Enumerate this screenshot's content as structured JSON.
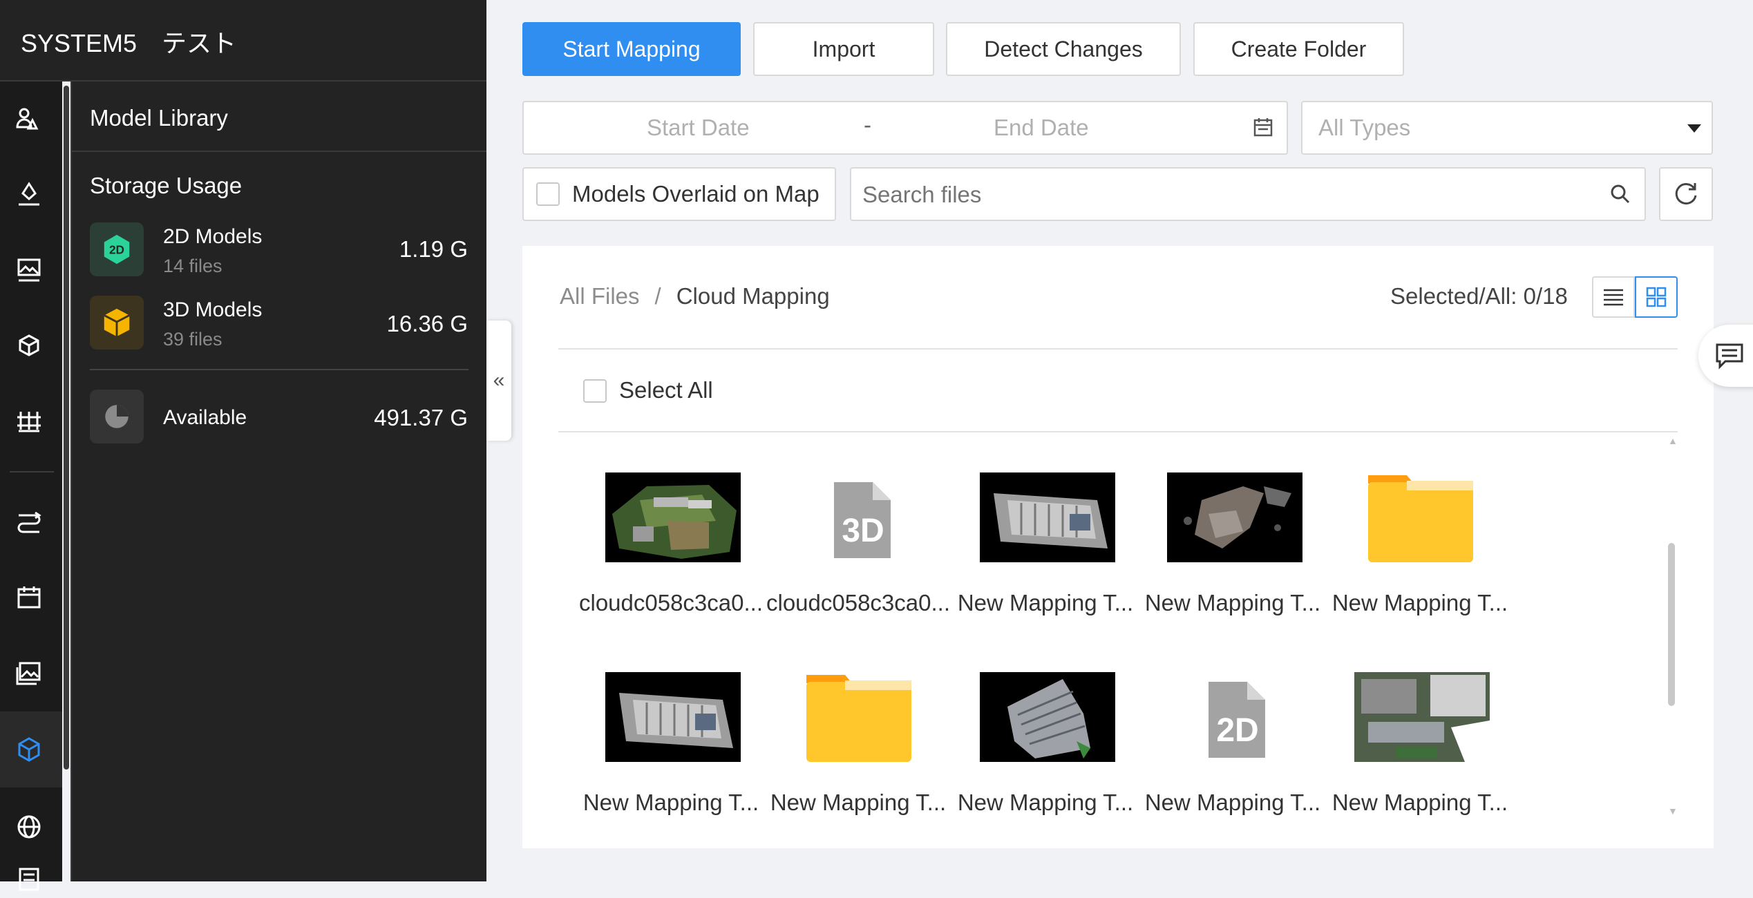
{
  "app": {
    "title": "SYSTEM5　テスト"
  },
  "rail": {
    "icons": [
      "team-icon",
      "waypoint-icon",
      "map-icon",
      "model-icon",
      "fence-icon",
      "route-icon",
      "calendar-icon",
      "gallery-icon",
      "cube-icon",
      "globe-icon",
      "document-icon"
    ],
    "active": "cube-icon"
  },
  "panel": {
    "title": "Model Library",
    "storage_title": "Storage Usage",
    "items": [
      {
        "name": "2D Models",
        "count": "14 files",
        "size": "1.19 G",
        "icon": "2d-model-icon",
        "color": "#2bd39a"
      },
      {
        "name": "3D Models",
        "count": "39 files",
        "size": "16.36 G",
        "icon": "3d-model-icon",
        "color": "#f5b400"
      },
      {
        "name": "Available",
        "count": "",
        "size": "491.37 G",
        "icon": "pie-chart-icon",
        "color": "#9a9a9a"
      }
    ],
    "collapse": "«"
  },
  "toolbar": {
    "start_mapping": "Start Mapping",
    "import": "Import",
    "detect_changes": "Detect Changes",
    "create_folder": "Create Folder"
  },
  "filters": {
    "start_date": "Start Date",
    "date_sep": "-",
    "end_date": "End Date",
    "type": "All Types",
    "overlay_label": "Models Overlaid on Map",
    "search_placeholder": "Search files"
  },
  "files": {
    "breadcrumb_root": "All Files",
    "breadcrumb_sep": "/",
    "breadcrumb_current": "Cloud Mapping",
    "selected": "Selected/All: 0/18",
    "select_all": "Select All",
    "items": [
      {
        "label": "cloudc058c3ca0...",
        "kind": "3d-thumb"
      },
      {
        "label": "cloudc058c3ca0...",
        "kind": "3d-file"
      },
      {
        "label": "New Mapping T...",
        "kind": "ortho-thumb"
      },
      {
        "label": "New Mapping T...",
        "kind": "pointcloud-thumb"
      },
      {
        "label": "New Mapping T...",
        "kind": "folder"
      },
      {
        "label": "New Mapping T...",
        "kind": "ortho-thumb"
      },
      {
        "label": "New Mapping T...",
        "kind": "folder"
      },
      {
        "label": "New Mapping T...",
        "kind": "roof-thumb"
      },
      {
        "label": "New Mapping T...",
        "kind": "2d-file"
      },
      {
        "label": "New Mapping T...",
        "kind": "aerial-thumb"
      }
    ]
  },
  "colors": {
    "primary": "#2f8ef0",
    "dark_bg": "#232323",
    "rail_bg": "#1b1b1b",
    "folder": "#ffc72c"
  }
}
